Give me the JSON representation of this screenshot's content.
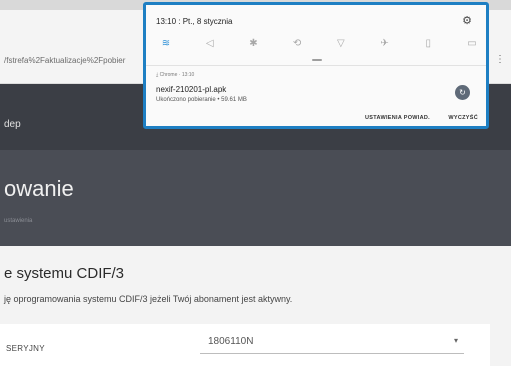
{
  "browser": {
    "url": "/fstrefa%2Faktualizacje%2Fpobier",
    "menu_glyph": "⋮"
  },
  "nav": {
    "title": "dep"
  },
  "hero": {
    "title": "owanie",
    "subtitle": "ustawienia"
  },
  "section": {
    "title": "e systemu CDIF/3",
    "description": "ję oprogramowania systemu CDIF/3 jeżeli Twój abonament jest aktywny."
  },
  "form": {
    "label": "SERYJNY",
    "value": "1806110N",
    "caret": "▾"
  },
  "notification_panel": {
    "time_date": "13:10 : Pt., 8 stycznia",
    "settings_icon": "gear-icon",
    "quick_toggles": [
      {
        "name": "wifi-icon",
        "glyph": "≋",
        "active": true
      },
      {
        "name": "sound-off-icon",
        "glyph": "◁",
        "active": false
      },
      {
        "name": "bluetooth-icon",
        "glyph": "✱",
        "active": false
      },
      {
        "name": "rotate-icon",
        "glyph": "⟲",
        "active": false
      },
      {
        "name": "flashlight-icon",
        "glyph": "▽",
        "active": false
      },
      {
        "name": "airplane-icon",
        "glyph": "✈",
        "active": false
      },
      {
        "name": "battery-saver-icon",
        "glyph": "▯",
        "active": false
      },
      {
        "name": "screen-icon",
        "glyph": "▭",
        "active": false
      }
    ],
    "notification": {
      "app": "⤓ Chrome · 13:10",
      "file": "nexif-210201-pl.apk",
      "status": "Ukończono pobieranie • 59.61 MB",
      "action_glyph": "↻"
    },
    "buttons": {
      "settings": "USTAWIENIA POWIAD.",
      "clear": "WYCZYŚĆ"
    }
  }
}
